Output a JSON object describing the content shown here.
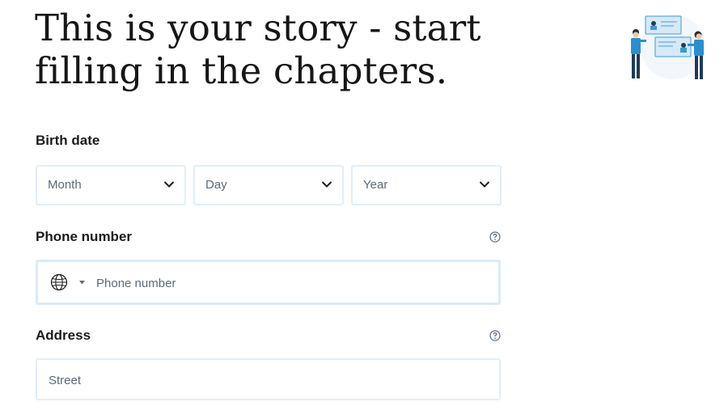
{
  "header": {
    "title": "This is your story - start filling in the chapters.",
    "illustration_icon": "people-profile-cards-illustration"
  },
  "birth_date": {
    "label": "Birth date",
    "month_placeholder": "Month",
    "day_placeholder": "Day",
    "year_placeholder": "Year",
    "chevron_icon": "chevron-down-icon"
  },
  "phone": {
    "label": "Phone number",
    "help_icon": "question-circle-icon",
    "country_icon": "globe-icon",
    "placeholder": "Phone number"
  },
  "address": {
    "label": "Address",
    "help_icon": "question-circle-icon",
    "street_placeholder": "Street"
  },
  "colors": {
    "text": "#1c1c1c",
    "placeholder": "#5b6b7b",
    "border": "#e2eef7",
    "accent": "#2a8fd0"
  }
}
